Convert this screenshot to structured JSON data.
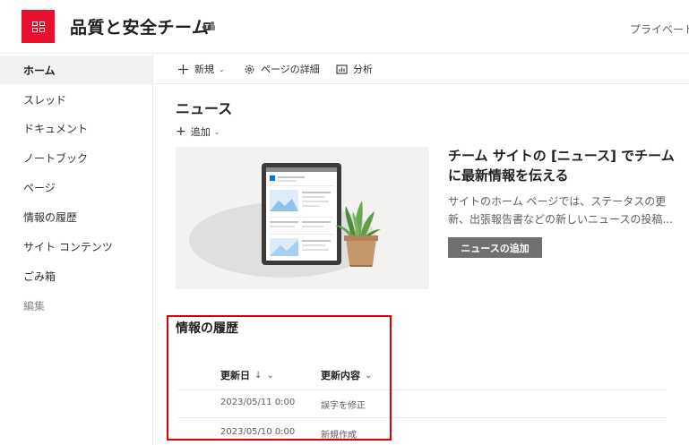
{
  "header": {
    "site_title": "品質と安全チーム",
    "privacy_label": "プライベート",
    "logo_icon": "sharepoint-site-logo-icon",
    "teams_icon": "teams-icon",
    "accent_color": "#e8112d"
  },
  "sidebar": {
    "items": [
      {
        "label": "ホーム"
      },
      {
        "label": "スレッド"
      },
      {
        "label": "ドキュメント"
      },
      {
        "label": "ノートブック"
      },
      {
        "label": "ページ"
      },
      {
        "label": "情報の履歴"
      },
      {
        "label": "サイト コンテンツ"
      },
      {
        "label": "ごみ箱"
      },
      {
        "label": "編集"
      }
    ],
    "active_index": 0
  },
  "command_bar": {
    "new_label": "新規",
    "page_details_label": "ページの詳細",
    "analytics_label": "分析"
  },
  "news": {
    "title": "ニュース",
    "add_label": "追加",
    "heading": "チーム サイトの [ニュース] でチームに最新情報を伝える",
    "description": "サイトのホーム ページでは、ステータスの更新、出張報告書などの新しいニュースの投稿...",
    "button_label": "ニュースの追加"
  },
  "history": {
    "title": "情報の履歴",
    "columns": {
      "updated_date": "更新日",
      "sort_arrow": "↓",
      "updated_content": "更新内容",
      "chevron": "⌄"
    },
    "rows": [
      {
        "date": "2023/05/11 0:00",
        "content": "誤字を修正"
      },
      {
        "date": "2023/05/10 0:00",
        "content": "新規作成"
      }
    ],
    "highlight_color": "#e00000"
  }
}
